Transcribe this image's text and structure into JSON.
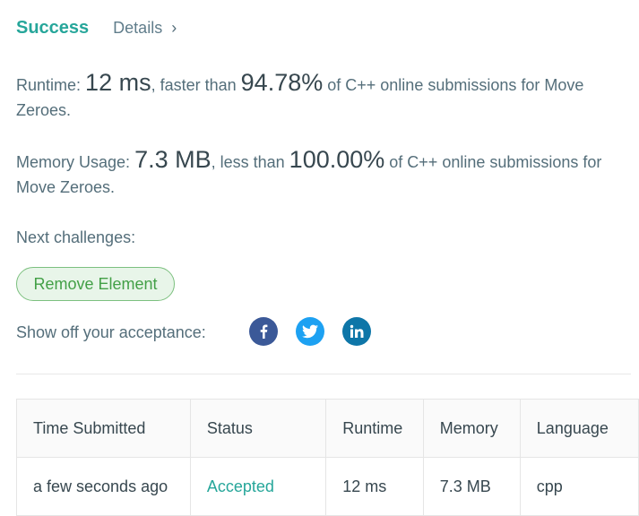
{
  "header": {
    "status": "Success",
    "details_label": "Details",
    "details_chevron": "›"
  },
  "runtime": {
    "label": "Runtime:",
    "value": "12 ms",
    "comparison": ", faster than",
    "percent": "94.78%",
    "suffix": "of C++ online submissions for Move Zeroes."
  },
  "memory": {
    "label": "Memory Usage:",
    "value": "7.3 MB",
    "comparison": ", less than",
    "percent": "100.00%",
    "suffix": "of C++ online submissions for Move Zeroes."
  },
  "next": {
    "label": "Next challenges:",
    "challenges": [
      "Remove Element"
    ]
  },
  "share": {
    "label": "Show off your acceptance:",
    "icons": [
      "facebook-icon",
      "twitter-icon",
      "linkedin-icon"
    ]
  },
  "table": {
    "headers": [
      "Time Submitted",
      "Status",
      "Runtime",
      "Memory",
      "Language"
    ],
    "rows": [
      [
        "a few seconds ago",
        "Accepted",
        "12 ms",
        "7.3 MB",
        "cpp"
      ]
    ]
  },
  "colors": {
    "success": "#26a69a",
    "accent_green": "#43a047",
    "facebook": "#3b5998",
    "twitter": "#1da1f2",
    "linkedin": "#0e76a8"
  }
}
